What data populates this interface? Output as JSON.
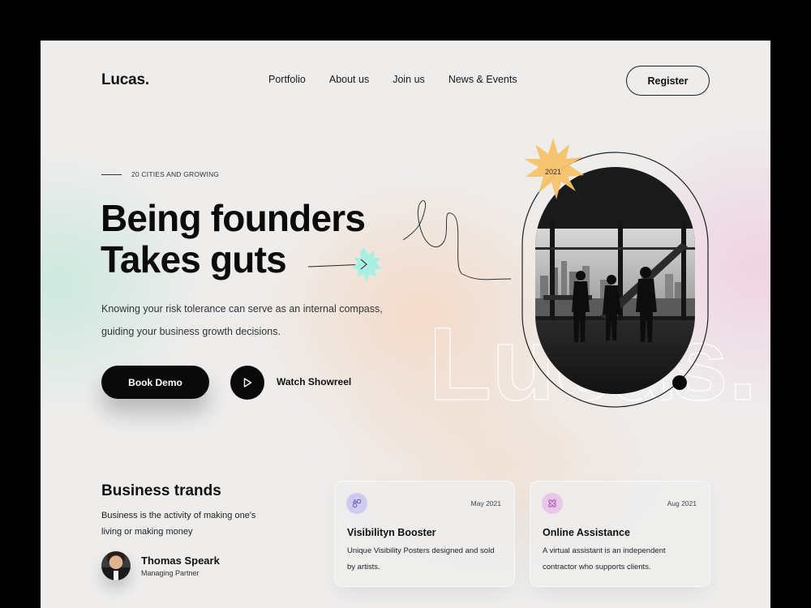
{
  "brand": {
    "logo": "Lucas.",
    "watermark": "Lucas."
  },
  "nav": {
    "items": [
      "Portfolio",
      "About us",
      "Join us",
      "News & Events"
    ],
    "register_label": "Register"
  },
  "hero": {
    "eyebrow": "20 CITIES AND GROWING",
    "headline_line1": "Being founders",
    "headline_line2": "Takes guts",
    "description": "Knowing your risk tolerance can serve as an internal compass, guiding your business growth decisions.",
    "book_demo_label": "Book Demo",
    "watch_label": "Watch Showreel",
    "badge_year": "2021"
  },
  "trends": {
    "title": "Business trands",
    "description": "Business is the activity of making one's living or making money",
    "person": {
      "name": "Thomas Speark",
      "role": "Managing Partner"
    }
  },
  "cards": [
    {
      "date": "May 2021",
      "title": "Visibilityn Booster",
      "description": "Unique Visibility Posters designed and sold by artists.",
      "icon": "shapes-icon",
      "icon_bg": "#cfcbee",
      "icon_color": "#6b60c8"
    },
    {
      "date": "Aug 2021",
      "title": "Online Assistance",
      "description": "A virtual assistant is an independent contractor who supports clients.",
      "icon": "puzzle-icon",
      "icon_bg": "#e8c8ea",
      "icon_color": "#a24aa8"
    }
  ],
  "colors": {
    "accent_star": "#f6c36a",
    "accent_mint": "#aaf0e2",
    "dark": "#0a0a0a"
  }
}
